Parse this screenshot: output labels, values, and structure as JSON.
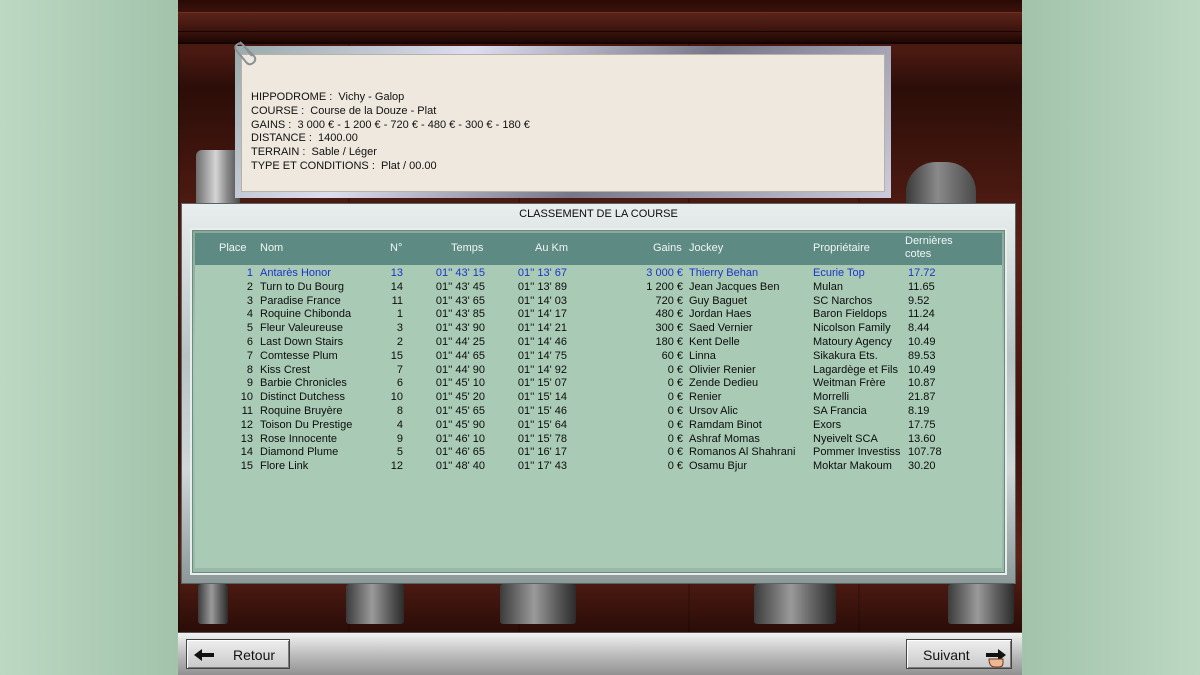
{
  "info": {
    "lines": [
      {
        "label": "HIPPODROME",
        "value": "Vichy - Galop"
      },
      {
        "label": "COURSE",
        "value": "Course de la Douze - Plat"
      },
      {
        "label": "GAINS",
        "value": "3 000 € - 1 200 € - 720 € - 480 € - 300 € - 180 €"
      },
      {
        "label": "DISTANCE",
        "value": "1400.00"
      },
      {
        "label": "TERRAIN",
        "value": "Sable / Léger"
      },
      {
        "label": "TYPE ET CONDITIONS",
        "value": "Plat / 00.00"
      }
    ]
  },
  "panel": {
    "title": "CLASSEMENT DE LA COURSE",
    "columns": {
      "place": "Place",
      "nom": "Nom",
      "numero": "N°",
      "temps": "Temps",
      "au_km": "Au Km",
      "gains": "Gains",
      "jockey": "Jockey",
      "proprietaire": "Propriétaire",
      "dernieres_cotes_1": "Dernières",
      "dernieres_cotes_2": "cotes"
    },
    "rows": [
      {
        "place": "1",
        "nom": "Antarès Honor",
        "num": "13",
        "temps": "01'' 43' 15",
        "km": "01'' 13' 67",
        "gains": "3 000 €",
        "jockey": "Thierry Behan",
        "prop": "Ecurie Top",
        "cote": "17.72"
      },
      {
        "place": "2",
        "nom": "Turn to Du Bourg",
        "num": "14",
        "temps": "01'' 43' 45",
        "km": "01'' 13' 89",
        "gains": "1 200 €",
        "jockey": "Jean Jacques Ben",
        "prop": "Mulan",
        "cote": "11.65"
      },
      {
        "place": "3",
        "nom": "Paradise France",
        "num": "11",
        "temps": "01'' 43' 65",
        "km": "01'' 14' 03",
        "gains": "720 €",
        "jockey": "Guy Baguet",
        "prop": "SC Narchos",
        "cote": "9.52"
      },
      {
        "place": "4",
        "nom": "Roquine Chibonda",
        "num": "1",
        "temps": "01'' 43' 85",
        "km": "01'' 14' 17",
        "gains": "480 €",
        "jockey": "Jordan Haes",
        "prop": "Baron Fieldops",
        "cote": "11.24"
      },
      {
        "place": "5",
        "nom": "Fleur Valeureuse",
        "num": "3",
        "temps": "01'' 43' 90",
        "km": "01'' 14' 21",
        "gains": "300 €",
        "jockey": "Saed Vernier",
        "prop": "Nicolson Family",
        "cote": "8.44"
      },
      {
        "place": "6",
        "nom": "Last Down Stairs",
        "num": "2",
        "temps": "01'' 44' 25",
        "km": "01'' 14' 46",
        "gains": "180 €",
        "jockey": "Kent Delle",
        "prop": "Matoury Agency",
        "cote": "10.49"
      },
      {
        "place": "7",
        "nom": "Comtesse Plum",
        "num": "15",
        "temps": "01'' 44' 65",
        "km": "01'' 14' 75",
        "gains": "60 €",
        "jockey": "Linna",
        "prop": "Sikakura Ets.",
        "cote": "89.53"
      },
      {
        "place": "8",
        "nom": "Kiss Crest",
        "num": "7",
        "temps": "01'' 44' 90",
        "km": "01'' 14' 92",
        "gains": "0 €",
        "jockey": "Olivier Renier",
        "prop": "Lagardège et Fils",
        "cote": "10.49"
      },
      {
        "place": "9",
        "nom": "Barbie Chronicles",
        "num": "6",
        "temps": "01'' 45' 10",
        "km": "01'' 15' 07",
        "gains": "0 €",
        "jockey": "Zende Dedieu",
        "prop": "Weitman Frère",
        "cote": "10.87"
      },
      {
        "place": "10",
        "nom": "Distinct Dutchess",
        "num": "10",
        "temps": "01'' 45' 20",
        "km": "01'' 15' 14",
        "gains": "0 €",
        "jockey": "Renier",
        "prop": "Morrelli",
        "cote": "21.87"
      },
      {
        "place": "11",
        "nom": "Roquine Bruyère",
        "num": "8",
        "temps": "01'' 45' 65",
        "km": "01'' 15' 46",
        "gains": "0 €",
        "jockey": "Ursov Alic",
        "prop": "SA Francia",
        "cote": "8.19"
      },
      {
        "place": "12",
        "nom": "Toison Du Prestige",
        "num": "4",
        "temps": "01'' 45' 90",
        "km": "01'' 15' 64",
        "gains": "0 €",
        "jockey": "Ramdam Binot",
        "prop": "Exors",
        "cote": "17.75"
      },
      {
        "place": "13",
        "nom": "Rose Innocente",
        "num": "9",
        "temps": "01'' 46' 10",
        "km": "01'' 15' 78",
        "gains": "0 €",
        "jockey": "Ashraf Momas",
        "prop": "Nyeivelt SCA",
        "cote": "13.60"
      },
      {
        "place": "14",
        "nom": "Diamond Plume",
        "num": "5",
        "temps": "01'' 46' 65",
        "km": "01'' 16' 17",
        "gains": "0 €",
        "jockey": "Romanos Al Shahrani",
        "prop": "Pommer Investiss",
        "cote": "107.78"
      },
      {
        "place": "15",
        "nom": "Flore Link",
        "num": "12",
        "temps": "01'' 48' 40",
        "km": "01'' 17' 43",
        "gains": "0 €",
        "jockey": "Osamu Bjur",
        "prop": "Moktar Makoum",
        "cote": "30.20"
      }
    ]
  },
  "nav": {
    "back_label": "Retour",
    "next_label": "Suivant"
  },
  "icons": {
    "back": "arrow-left-icon",
    "next": "pointing-hand-icon",
    "clip": "paperclip-icon"
  },
  "colors": {
    "highlight_row": "#1c34c8",
    "header_bg": "#5d8b84",
    "table_bg": "#a9cbb6"
  }
}
